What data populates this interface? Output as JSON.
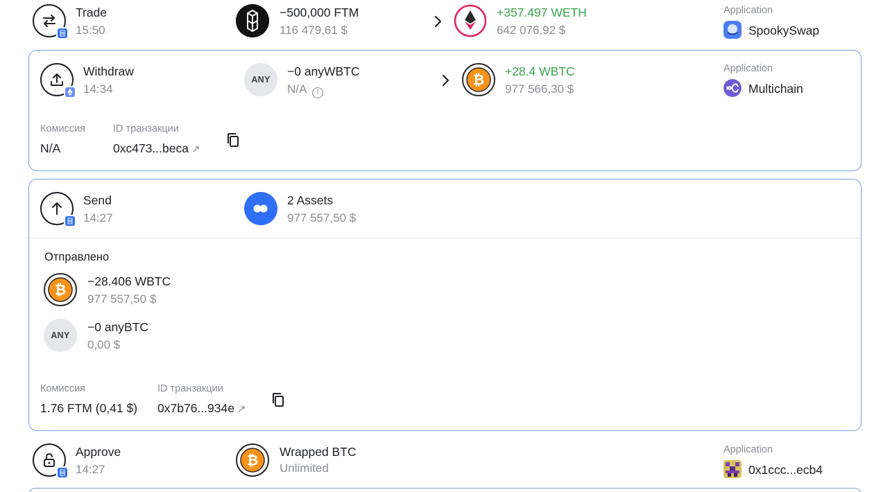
{
  "labels": {
    "application": "Application",
    "commission": "Комиссия",
    "tx_id": "ID транзакции",
    "sent": "Отправлено"
  },
  "trade": {
    "type": "Trade",
    "time": "15:50",
    "from_amount": "−500,000 FTM",
    "from_value": "116 479,61 $",
    "to_amount": "+357.497 WETH",
    "to_value": "642 076,92 $",
    "app_name": "SpookySwap"
  },
  "withdraw": {
    "type": "Withdraw",
    "time": "14:34",
    "token_badge": "ANY",
    "from_amount": "−0 anyWBTC",
    "from_value": "N/A",
    "to_amount": "+28.4 WBTC",
    "to_value": "977 566,30 $",
    "app_name": "Multichain",
    "commission": "N/A",
    "tx_id": "0xc473...beca"
  },
  "send": {
    "type": "Send",
    "time": "14:27",
    "assets_title": "2 Assets",
    "assets_value": "977 557,50 $",
    "items": [
      {
        "amount": "−28.406 WBTC",
        "value": "977 557,50 $"
      },
      {
        "badge": "ANY",
        "amount": "−0 anyBTC",
        "value": "0,00 $"
      }
    ],
    "commission": "1.76 FTM (0,41 $)",
    "tx_id": "0x7b76...934e"
  },
  "approve": {
    "type": "Approve",
    "time": "14:27",
    "token_name": "Wrapped BTC",
    "allowance": "Unlimited",
    "app_name": "0x1ccc...ecb4"
  },
  "colors": {
    "card_border": "#7f9cdc",
    "positive": "#3aa64c",
    "muted": "#8a8d93",
    "chain_badge": "#2f6ef6",
    "bitcoin": "#f7931a"
  },
  "icons": [
    "swap-icon",
    "withdraw-icon",
    "send-icon",
    "approve-lock-icon",
    "fantom-token-icon",
    "weth-token-icon",
    "wbtc-token-icon",
    "any-token-icon",
    "multi-assets-icon",
    "spookyswap-app-icon",
    "multichain-app-icon",
    "contract-avatar-icon",
    "copy-icon",
    "external-link-icon",
    "info-icon",
    "chevron-right-icon"
  ]
}
